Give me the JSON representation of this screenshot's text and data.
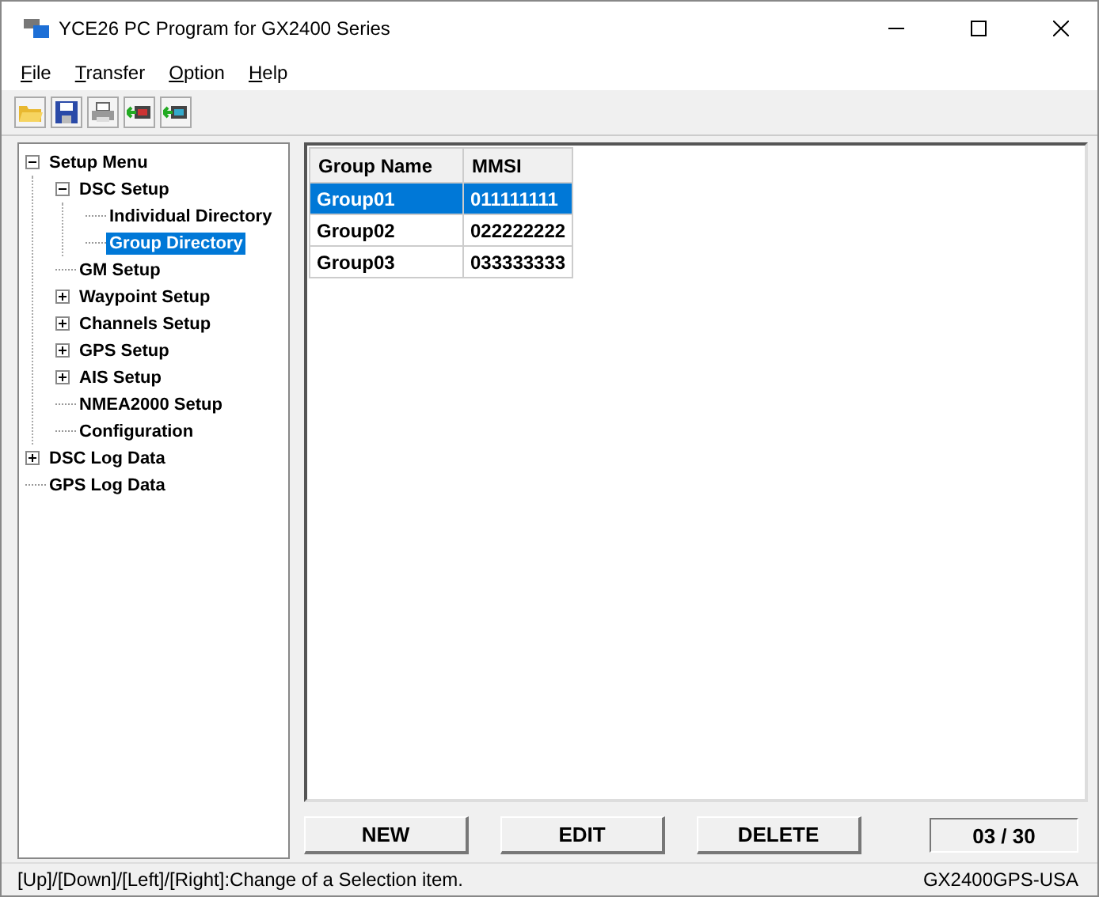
{
  "window": {
    "title": "YCE26 PC Program for GX2400 Series"
  },
  "menu": [
    "File",
    "Transfer",
    "Option",
    "Help"
  ],
  "toolbar": [
    {
      "kind": "open"
    },
    {
      "kind": "save"
    },
    {
      "kind": "print"
    },
    {
      "kind": "read"
    },
    {
      "kind": "write"
    }
  ],
  "tree": [
    {
      "label": "Setup Menu",
      "expanded": true,
      "selected": false,
      "children": [
        {
          "label": "DSC Setup",
          "expanded": true,
          "selected": false,
          "children": [
            {
              "label": "Individual Directory",
              "selected": false
            },
            {
              "label": "Group Directory",
              "selected": true
            }
          ]
        },
        {
          "label": "GM Setup",
          "selected": false
        },
        {
          "label": "Waypoint Setup",
          "expanded": false,
          "selected": false
        },
        {
          "label": "Channels Setup",
          "expanded": false,
          "selected": false
        },
        {
          "label": "GPS Setup",
          "expanded": false,
          "selected": false
        },
        {
          "label": "AIS Setup",
          "expanded": false,
          "selected": false
        },
        {
          "label": "NMEA2000 Setup",
          "selected": false
        },
        {
          "label": "Configuration",
          "selected": false
        }
      ]
    },
    {
      "label": "DSC Log Data",
      "expanded": false,
      "selected": false
    },
    {
      "label": "GPS Log Data",
      "selected": false
    }
  ],
  "table": {
    "columns": [
      "Group Name",
      "MMSI"
    ],
    "rows": [
      {
        "cells": [
          "Group01",
          "011111111"
        ],
        "selected": true
      },
      {
        "cells": [
          "Group02",
          "022222222"
        ],
        "selected": false
      },
      {
        "cells": [
          "Group03",
          "033333333"
        ],
        "selected": false
      }
    ]
  },
  "buttons": [
    "NEW",
    "EDIT",
    "DELETE"
  ],
  "counter": "03 / 30",
  "status_bar": {
    "hint": "[Up]/[Down]/[Left]/[Right]:Change of a Selection item.",
    "model": "GX2400GPS-USA"
  }
}
